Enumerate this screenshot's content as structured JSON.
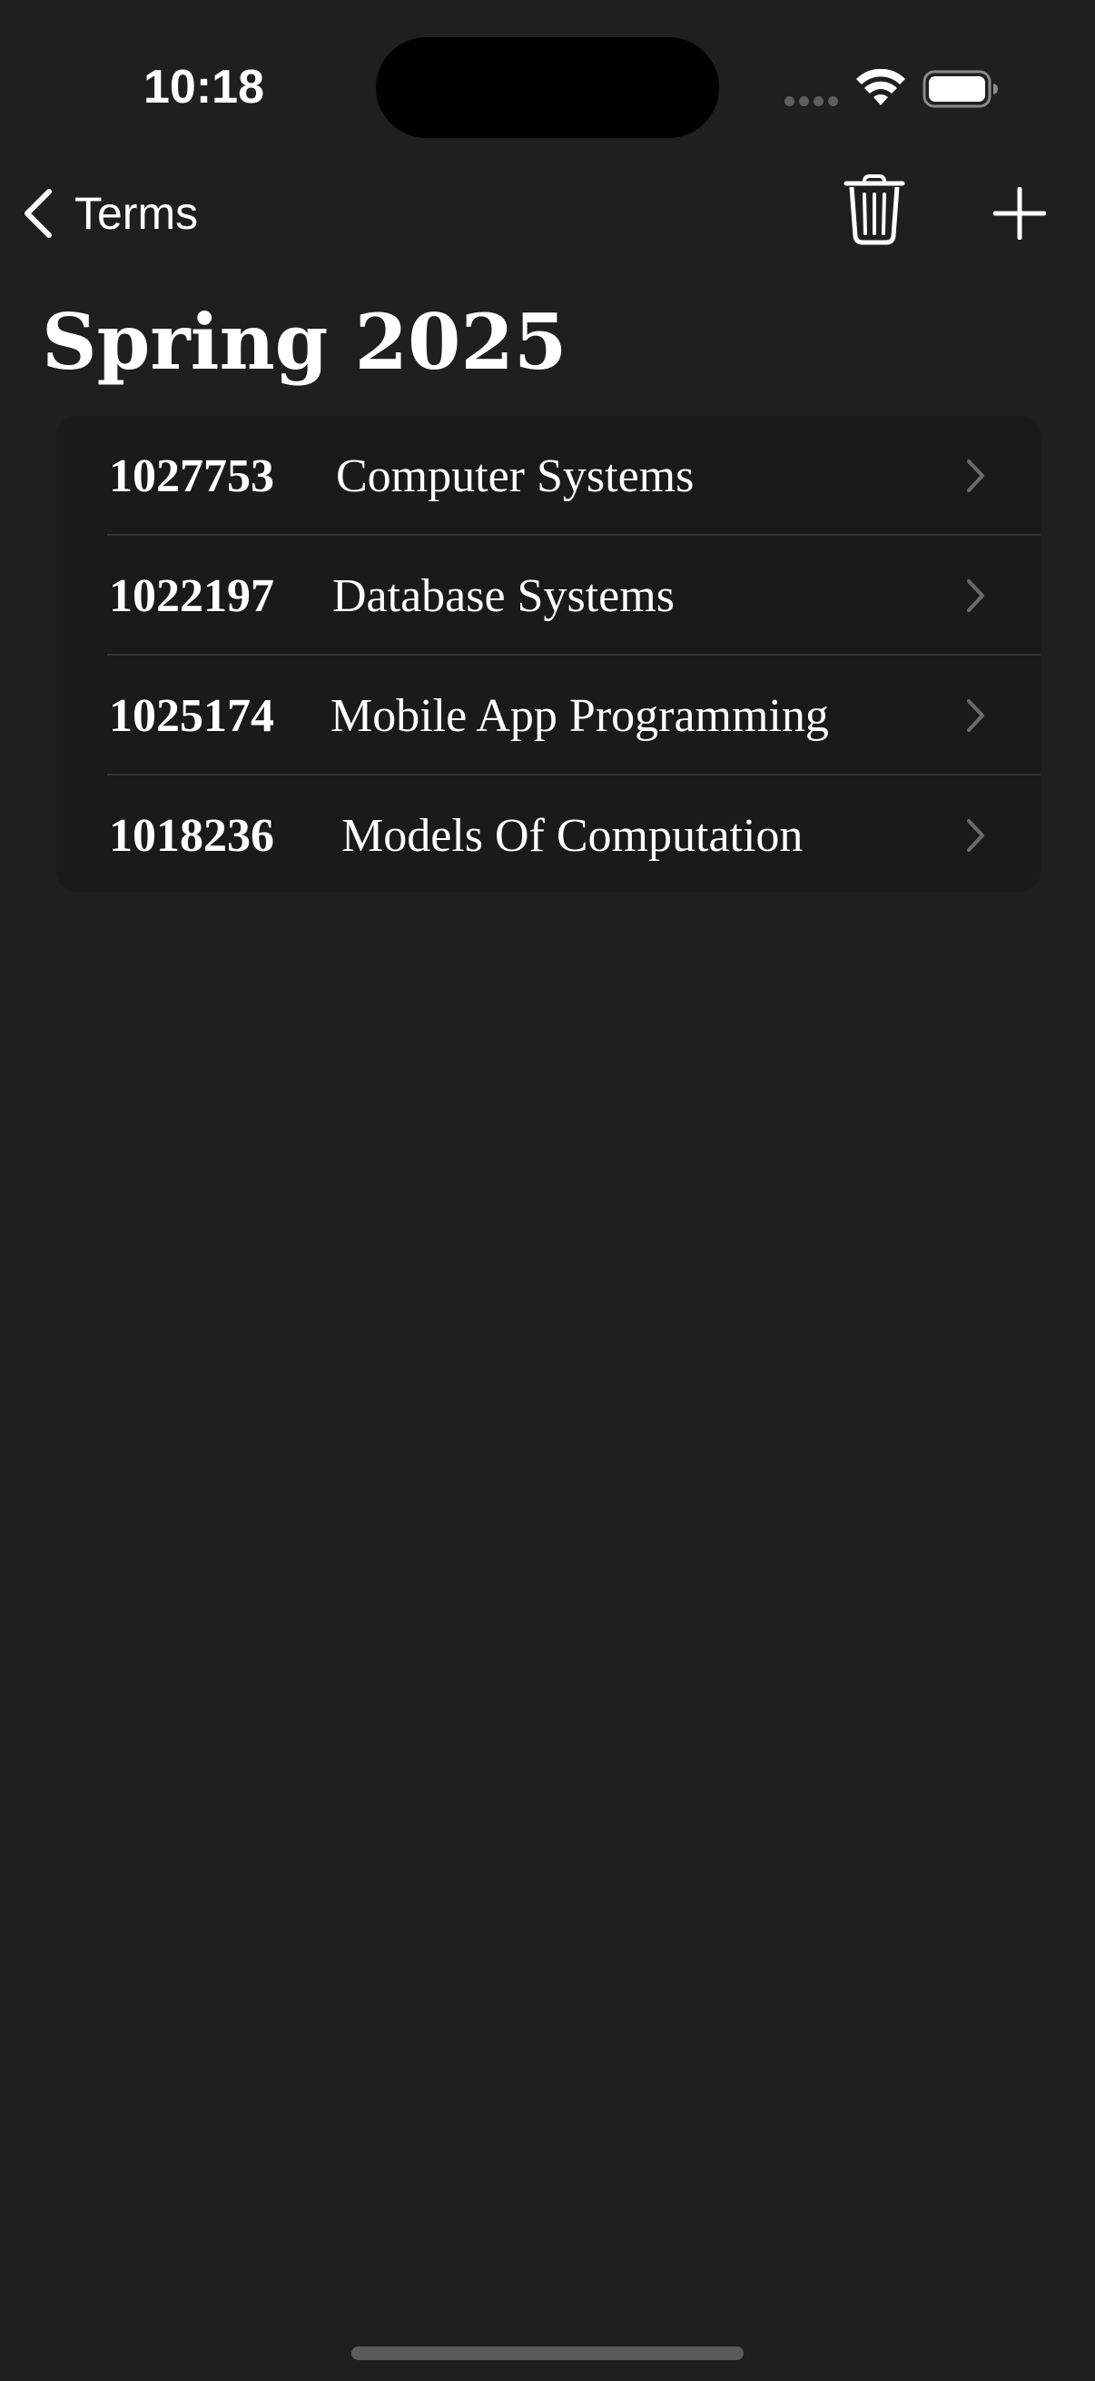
{
  "status_bar": {
    "time": "10:18",
    "wifi_icon": "wifi-icon",
    "battery_icon": "battery-icon",
    "signal_icon": "signal-dots-icon"
  },
  "nav": {
    "back_label": "Terms",
    "back_icon": "chevron-left-icon",
    "trash_icon": "trash-icon",
    "add_icon": "plus-icon"
  },
  "title": "Spring 2025",
  "courses": [
    {
      "code": "1027753",
      "name": "Computer Systems"
    },
    {
      "code": "1022197",
      "name": "Database Systems"
    },
    {
      "code": "1025174",
      "name": "Mobile App Programming"
    },
    {
      "code": "1018236",
      "name": "Models Of Computation"
    }
  ],
  "colors": {
    "background": "#1f1f1f",
    "list_background": "#1a1a1b",
    "text": "#ffffff",
    "chevron": "#6b6b6e",
    "separator": "#333335"
  }
}
